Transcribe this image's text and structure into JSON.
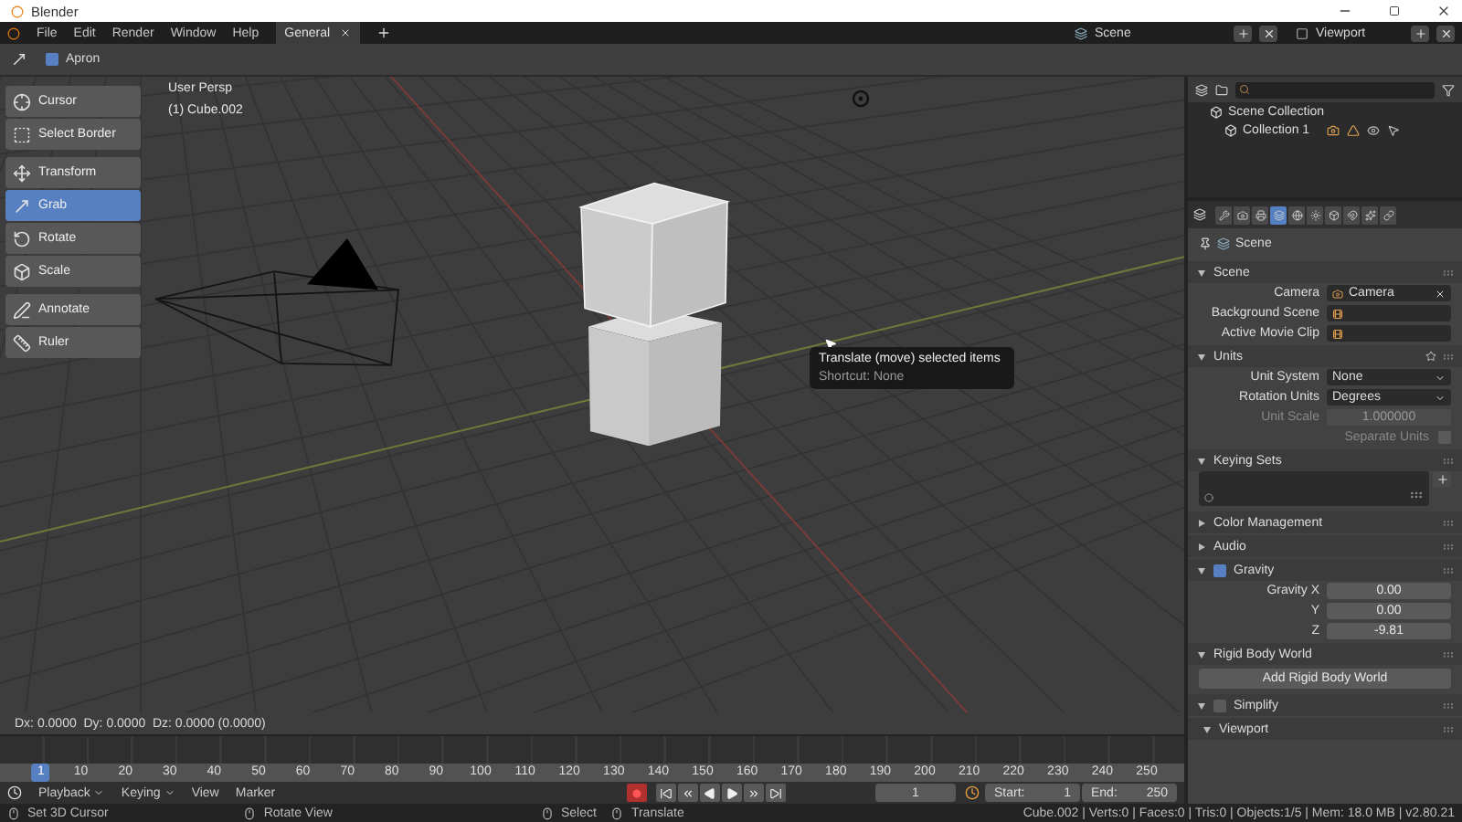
{
  "window": {
    "title": "Blender"
  },
  "menu": [
    "File",
    "Edit",
    "Render",
    "Window",
    "Help"
  ],
  "workspace_tabs": [
    {
      "label": "General",
      "selected": true
    }
  ],
  "scene": {
    "label": "Scene"
  },
  "view_layer": {
    "label": "Viewport"
  },
  "tool_header": {
    "apron": {
      "label": "Apron",
      "checked": true
    }
  },
  "toolbar": [
    {
      "tools": [
        {
          "label": "Cursor",
          "selected": false
        },
        {
          "label": "Select Border",
          "selected": false
        }
      ]
    },
    {
      "tools": [
        {
          "label": "Transform",
          "selected": false
        },
        {
          "label": "Grab",
          "selected": true
        },
        {
          "label": "Rotate",
          "selected": false
        },
        {
          "label": "Scale",
          "selected": false
        }
      ]
    },
    {
      "tools": [
        {
          "label": "Annotate",
          "selected": false
        },
        {
          "label": "Ruler",
          "selected": false
        }
      ]
    }
  ],
  "viewport": {
    "view_name": "User Persp",
    "object_name": "(1) Cube.002",
    "tooltip": {
      "title": "Translate (move) selected items",
      "shortcut": "Shortcut: None"
    },
    "readout": "Dx: 0.0000  Dy: 0.0000  Dz: 0.0000 (0.0000)"
  },
  "outliner": {
    "items": [
      {
        "label": "Scene Collection",
        "children": [
          {
            "label": "Collection 1"
          }
        ]
      }
    ]
  },
  "properties": {
    "tabs": [
      {
        "selected": false
      },
      {
        "selected": false
      },
      {
        "selected": false
      },
      {
        "selected": true
      },
      {
        "selected": false
      },
      {
        "selected": false
      },
      {
        "selected": false
      },
      {
        "selected": false
      },
      {
        "selected": false
      },
      {
        "selected": false
      }
    ],
    "context": "Scene",
    "panels": [
      {
        "title": "Scene",
        "kind": "plain",
        "expanded": true,
        "rows": [
          {
            "kind": "field",
            "label": "Camera",
            "value": "Camera"
          },
          {
            "kind": "field",
            "label": "Background Scene"
          },
          {
            "kind": "field",
            "label": "Active Movie Clip"
          }
        ]
      },
      {
        "title": "Units",
        "kind": "plain",
        "expanded": true,
        "has_presets": true,
        "rows": [
          {
            "kind": "dropdown",
            "label": "Unit System",
            "value": "None",
            "disabled": false
          },
          {
            "kind": "dropdown",
            "label": "Rotation Units",
            "value": "Degrees",
            "disabled": false
          },
          {
            "kind": "number",
            "label": "Unit Scale",
            "value": "1.000000",
            "disabled": true
          },
          {
            "kind": "checkbox",
            "label": "Separate Units",
            "checked": false,
            "disabled": true
          }
        ]
      },
      {
        "title": "Keying Sets",
        "kind": "plain",
        "expanded": true,
        "rows": [
          {
            "kind": "list"
          }
        ]
      },
      {
        "title": "Color Management",
        "kind": "plain",
        "expanded": false
      },
      {
        "title": "Audio",
        "kind": "plain",
        "expanded": false
      },
      {
        "title": "Gravity",
        "kind": "toggle",
        "checked": true,
        "expanded": true,
        "rows": [
          {
            "kind": "number",
            "label": "Gravity X",
            "value": "0.00"
          },
          {
            "kind": "number",
            "label": "Y",
            "value": "0.00"
          },
          {
            "kind": "number",
            "label": "Z",
            "value": "-9.81"
          }
        ]
      },
      {
        "title": "Rigid Body World",
        "kind": "plain",
        "expanded": true,
        "rows": [
          {
            "kind": "button",
            "label": "Add Rigid Body World"
          }
        ]
      },
      {
        "title": "Simplify",
        "kind": "toggle",
        "checked": false,
        "expanded": true
      },
      {
        "title": "Viewport",
        "kind": "subpanel",
        "expanded": true
      }
    ]
  },
  "timeline": {
    "menus": [
      {
        "label": "Playback",
        "dropdown": true
      },
      {
        "label": "Keying",
        "dropdown": true
      },
      {
        "label": "View",
        "dropdown": false
      },
      {
        "label": "Marker",
        "dropdown": false
      }
    ],
    "playhead": "1",
    "ruler": [
      "10",
      "20",
      "30",
      "40",
      "50",
      "60",
      "70",
      "80",
      "90",
      "100",
      "110",
      "120",
      "130",
      "140",
      "150",
      "160",
      "170",
      "180",
      "190",
      "200",
      "210",
      "220",
      "230",
      "240",
      "250"
    ],
    "current_frame": "1",
    "start": {
      "label": "Start:",
      "value": "1"
    },
    "end": {
      "label": "End:",
      "value": "250"
    }
  },
  "status_bar": {
    "hints": [
      "Set 3D Cursor",
      "Rotate View",
      "Select",
      "Translate"
    ],
    "stats": "Cube.002 | Verts:0 | Faces:0 | Tris:0 | Objects:1/5 | Mem: 18.0 MB | v2.80.21"
  }
}
